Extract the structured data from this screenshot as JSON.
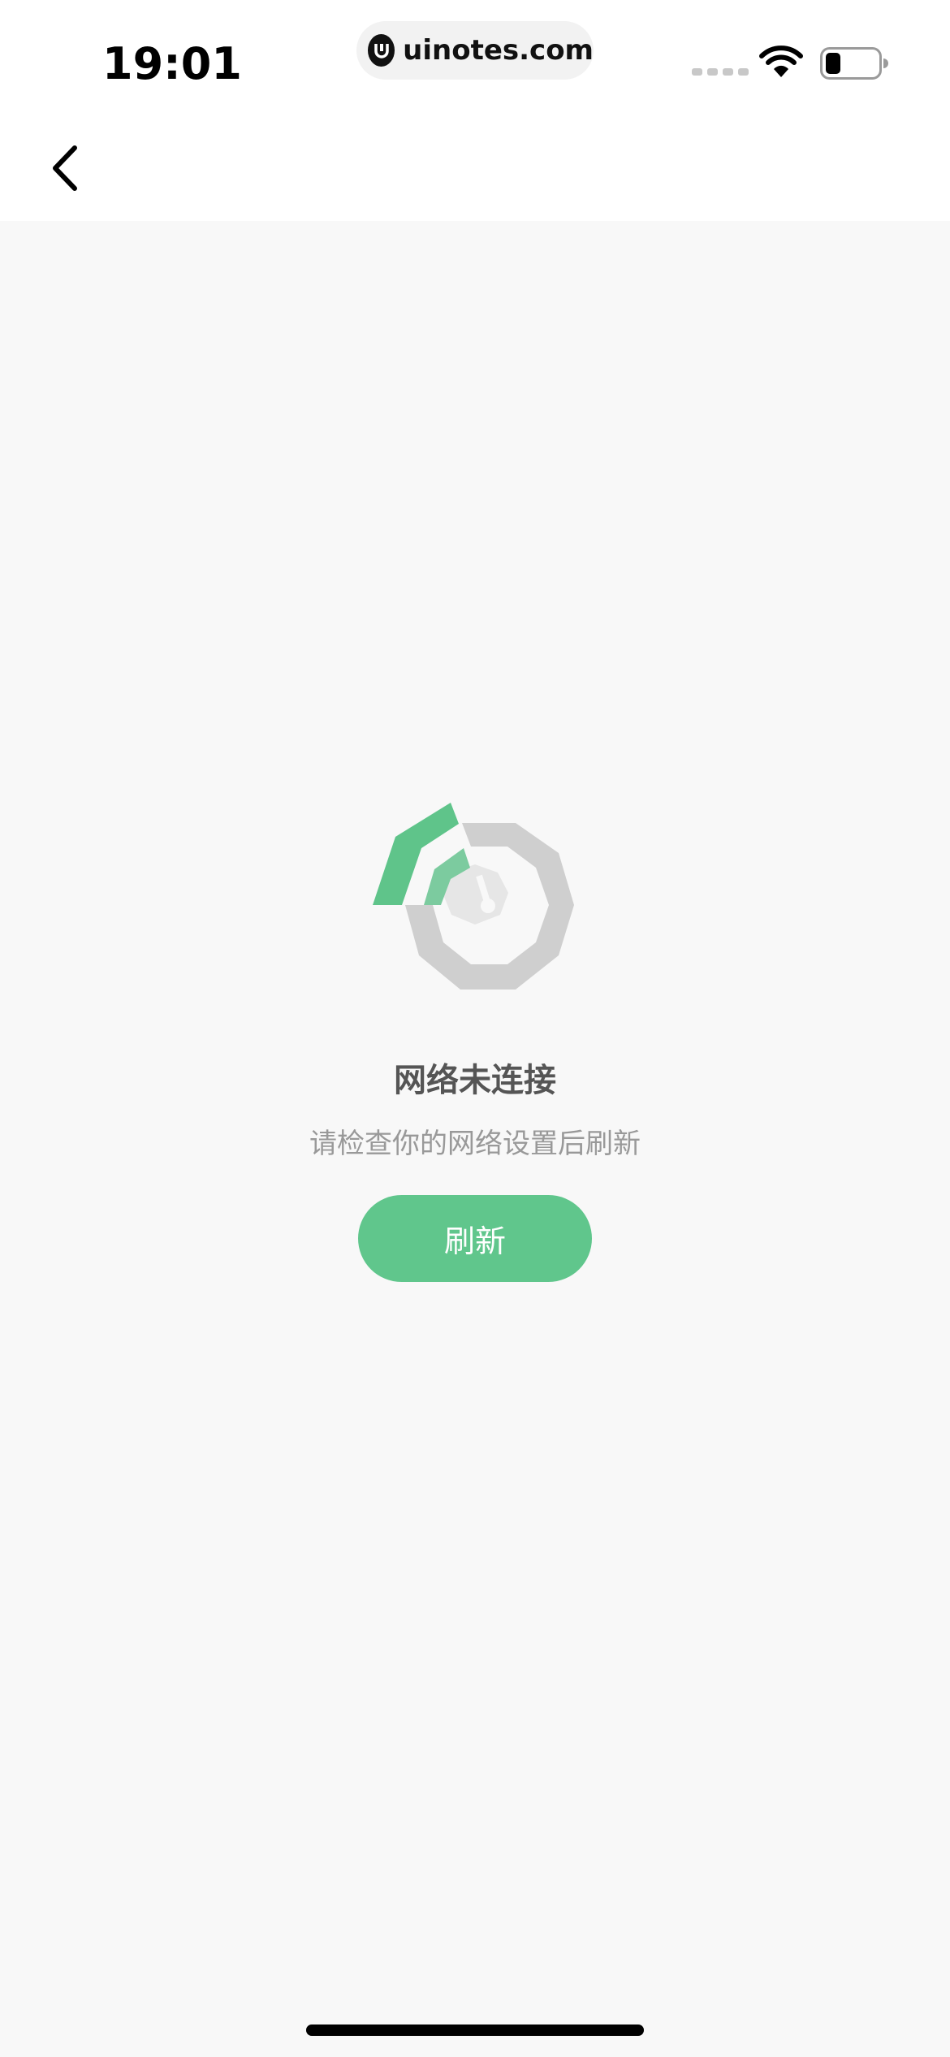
{
  "status_bar": {
    "time": "19:01",
    "url": "uinotes.com"
  },
  "nav": {
    "back_icon": "chevron-left-icon"
  },
  "empty_state": {
    "icon": "no-network-illustration",
    "title": "网络未连接",
    "subtitle": "请检查你的网络设置后刷新",
    "button_label": "刷新"
  },
  "colors": {
    "accent": "#60c68c",
    "illustration_gray": "#cfcfcf",
    "illustration_green": "#5fc48a",
    "background": "#f8f8f8"
  }
}
